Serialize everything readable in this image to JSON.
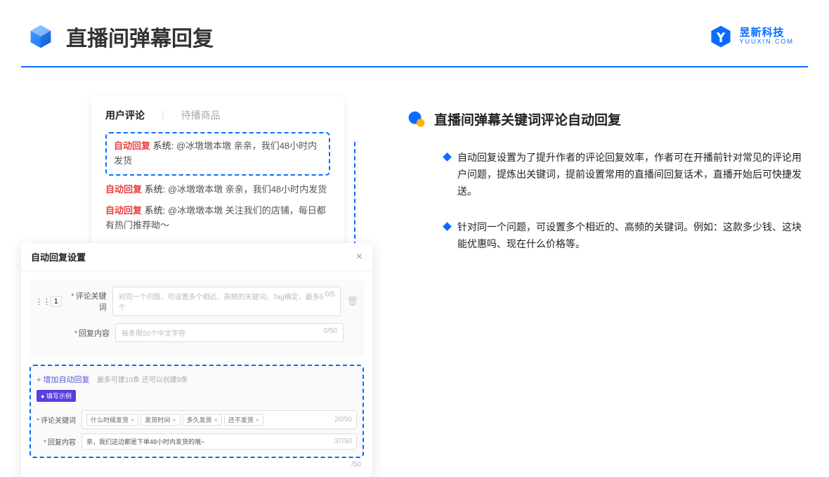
{
  "header": {
    "title": "直播间弹幕回复",
    "logo_main": "昱新科技",
    "logo_sub": "YUUXIN.COM"
  },
  "right": {
    "section_title": "直播间弹幕关键词评论自动回复",
    "bullets": [
      "自动回复设置为了提升作者的评论回复效率，作者可在开播前针对常见的评论用户问题，提炼出关键词，提前设置常用的直播间回复话术，直播开始后可快捷发送。",
      "针对同一个问题，可设置多个相近的、高频的关键词。例如：这款多少钱、这块能优惠吗、现在什么价格等。"
    ]
  },
  "card1": {
    "tab_comments": "用户评论",
    "tab_pending": "待播商品",
    "auto_label": "自动回复",
    "sys_label": "系统:",
    "msg_highlight": "@冰墩墩本墩 亲亲，我们48小时内发货",
    "msg2": "@冰墩墩本墩 亲亲，我们48小时内发货",
    "msg3": "@冰墩墩本墩 关注我们的店铺，每日都有热门推荐呦～"
  },
  "card2": {
    "title": "自动回复设置",
    "row_num": "1",
    "label_keyword": "评论关键词",
    "label_content": "回复内容",
    "placeholder_keyword": "对同一个问题，可设置多个相近、高频的关键词，Tag确定，最多5个",
    "counter_keyword": "0/5",
    "placeholder_content": "每条限50个中文字符",
    "counter_content": "0/50",
    "add_link": "+ 增加自动回复",
    "add_hint": "最多可建10条 还可以创建9条",
    "example_tag": "● 填写示例",
    "ex_label_keyword": "评论关键词",
    "ex_tags": [
      "什么时候发货",
      "发货时间",
      "多久发货",
      "还不发货"
    ],
    "ex_counter_kw": "20/50",
    "ex_label_content": "回复内容",
    "ex_content": "亲，我们这边都是下单48小时内发货的哦~",
    "ex_counter_ct": "37/50",
    "outer_counter": "/50"
  }
}
